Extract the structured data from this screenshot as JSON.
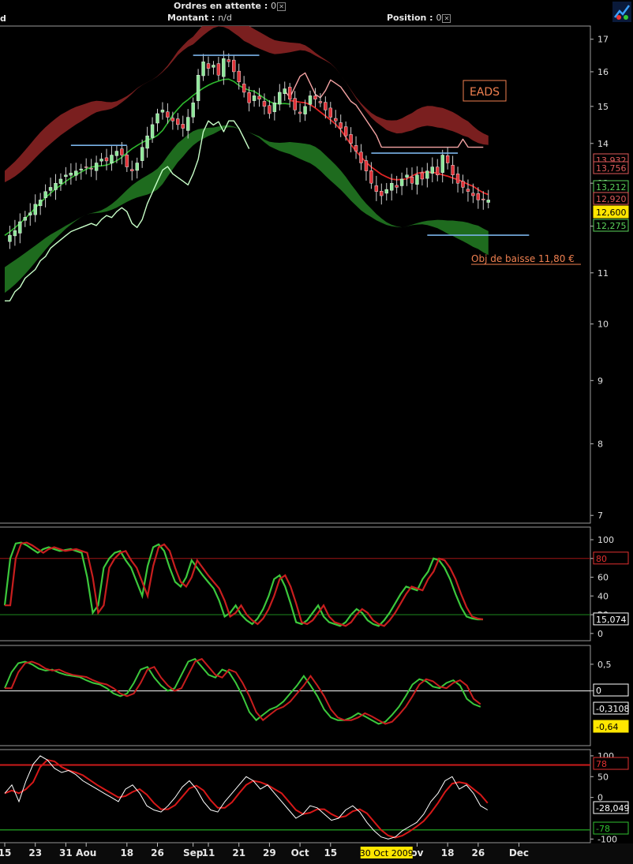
{
  "topbar": {
    "orders_label": "Ordres en attente :",
    "orders_value": "0",
    "amount_label": "Montant :",
    "amount_value": "n/d",
    "position_label": "Position :",
    "position_value": "0",
    "left_fragment": "d"
  },
  "colors": {
    "background": "#000000",
    "up_candle": "#8fe89a",
    "down_candle": "#e0343a",
    "red_band": "#7a1f1f",
    "green_band": "#1e6b1e",
    "ma_red": "#e02424",
    "ma_green": "#2db82d",
    "stop_pink": "#f4a3a3",
    "stop_lightgreen": "#c8ffc8",
    "level_blue": "#7ab3e8",
    "annotation": "#f08050",
    "highlight": "#ffe600"
  },
  "chart_data": [
    {
      "type": "candlestick",
      "panel": "price",
      "annotation_title": "EADS",
      "annotation_target": "Obj de baisse 11,80 €",
      "y_ticks": [
        7,
        8,
        9,
        10,
        11,
        12,
        13,
        14,
        15,
        16,
        17
      ],
      "ylim": [
        6.9,
        17.5
      ],
      "log_scale": true,
      "price_labels": [
        {
          "text": "13,932",
          "value": 13.932,
          "color": "#e05a5a"
        },
        {
          "text": "13,756",
          "value": 13.756,
          "color": "#e05a5a"
        },
        {
          "text": "13,212",
          "value": 13.212,
          "color": "#5ad25a"
        },
        {
          "text": "12,920",
          "value": 12.92,
          "color": "#e05a5a"
        },
        {
          "text": "12,600",
          "value": 12.6,
          "color": "#ffe600"
        },
        {
          "text": "12,275",
          "value": 12.275,
          "color": "#5ad25a"
        }
      ],
      "horizontal_levels": [
        {
          "name": "resistance-aug",
          "value": 13.95,
          "from": 13,
          "to": 24
        },
        {
          "name": "resistance-sep",
          "value": 16.5,
          "from": 37,
          "to": 50
        },
        {
          "name": "resistance-nov",
          "value": 13.75,
          "from": 72,
          "to": 89
        },
        {
          "name": "objective",
          "value": 11.8,
          "from": 83,
          "to": 103
        }
      ]
    },
    {
      "type": "line",
      "panel": "stochastic",
      "y_ticks": [
        0,
        20,
        40,
        60,
        80,
        100
      ],
      "ylim": [
        0,
        100
      ],
      "level_labels": [
        {
          "text": "80",
          "value": 80,
          "color": "#e03030"
        },
        {
          "text": "15,074",
          "value": 15.074,
          "color": "#ffffff"
        }
      ],
      "levels": [
        {
          "value": 80,
          "color": "#a01515"
        },
        {
          "value": 20,
          "color": "#1e8a1e"
        }
      ]
    },
    {
      "type": "line",
      "panel": "oscillator",
      "y_ticks": [
        0.5,
        0
      ],
      "tick_texts": [
        "0,5",
        "0"
      ],
      "ylim": [
        -1.0,
        0.75
      ],
      "level_labels": [
        {
          "text": "0",
          "value": 0,
          "color": "#ffffff"
        },
        {
          "text": "-0,3108",
          "value": -0.3108,
          "color": "#ffffff"
        },
        {
          "text": "-0,64",
          "value": -0.64,
          "color": "#ffe600"
        }
      ],
      "levels": [
        {
          "value": 0,
          "color": "#ffffff"
        }
      ]
    },
    {
      "type": "line",
      "panel": "cci",
      "y_ticks": [
        100,
        50,
        0,
        -100
      ],
      "ylim": [
        -105,
        115
      ],
      "level_labels": [
        {
          "text": "78",
          "value": 78,
          "color": "#e03030"
        },
        {
          "text": "-28,049",
          "value": -28.049,
          "color": "#ffffff"
        },
        {
          "text": "-78",
          "value": -78,
          "color": "#30c030"
        }
      ],
      "levels": [
        {
          "value": 78,
          "color": "#cc1a1a"
        },
        {
          "value": -78,
          "color": "#1e8a1e"
        }
      ]
    }
  ],
  "x_axis": {
    "labels": [
      {
        "text": "15",
        "i": 0
      },
      {
        "text": "23",
        "i": 6
      },
      {
        "text": "31",
        "i": 12
      },
      {
        "text": "Aou",
        "i": 16
      },
      {
        "text": "18",
        "i": 24
      },
      {
        "text": "26",
        "i": 30
      },
      {
        "text": "Sep",
        "i": 37
      },
      {
        "text": "11",
        "i": 40
      },
      {
        "text": "21",
        "i": 46
      },
      {
        "text": "29",
        "i": 52
      },
      {
        "text": "Oct",
        "i": 58
      },
      {
        "text": "15",
        "i": 64
      },
      {
        "text": "ov",
        "i": 81
      },
      {
        "text": "18",
        "i": 87
      },
      {
        "text": "26",
        "i": 93
      },
      {
        "text": "Dec",
        "i": 101
      }
    ],
    "cursor_label": "30 Oct 2009",
    "cursor_i": 75
  },
  "ohlc_series_note_free": true
}
